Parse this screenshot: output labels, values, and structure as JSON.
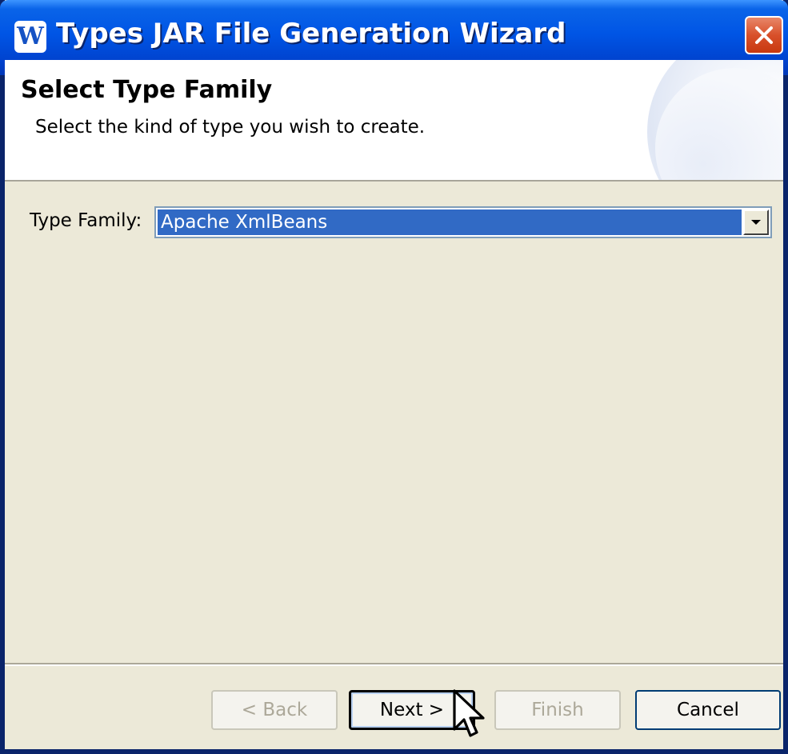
{
  "window": {
    "title": "Types JAR File Generation Wizard",
    "app_icon_glyph": "W",
    "colors": {
      "titlebar": "#0055e5",
      "close": "#d8502a",
      "selection": "#316ac5",
      "dialog_bg": "#ece9d8"
    }
  },
  "header": {
    "title": "Select Type Family",
    "description": "Select the kind of type you wish to create."
  },
  "form": {
    "type_family_label": "Type Family:",
    "type_family_value": "Apache XmlBeans"
  },
  "buttons": {
    "back": "< Back",
    "next": "Next >",
    "finish": "Finish",
    "cancel": "Cancel"
  },
  "icons": [
    "app-icon",
    "close-icon",
    "dropdown-arrow-icon",
    "mouse-cursor-icon"
  ]
}
